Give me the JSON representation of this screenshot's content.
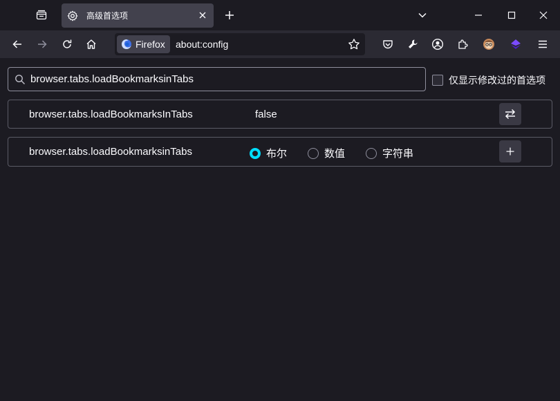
{
  "tab": {
    "title": "高级首选项"
  },
  "identity": {
    "label": "Firefox"
  },
  "urlbar": {
    "url": "about:config"
  },
  "search": {
    "query": "browser.tabs.loadBookmarksinTabs"
  },
  "filter": {
    "modified_only_label": "仅显示修改过的首选项"
  },
  "prefs": [
    {
      "name": "browser.tabs.loadBookmarksInTabs",
      "value": "false"
    },
    {
      "name": "browser.tabs.loadBookmarksinTabs"
    }
  ],
  "new_pref_types": {
    "boolean": "布尔",
    "number": "数值",
    "string": "字符串",
    "selected": "boolean"
  },
  "colors": {
    "accent": "#00ddff",
    "background": "#1c1b22",
    "toolbar": "#2b2a33",
    "tab_selected": "#42414d"
  },
  "icons": [
    "tab-list-icon",
    "gear-icon",
    "close-icon",
    "plus-icon",
    "chevron-down-icon",
    "minimize-icon",
    "maximize-icon",
    "back-icon",
    "forward-icon",
    "reload-icon",
    "home-icon",
    "firefox-logo-icon",
    "star-icon",
    "pocket-icon",
    "wrench-icon",
    "account-icon",
    "extensions-icon",
    "avatar-extension-icon",
    "purple-extension-icon",
    "menu-icon",
    "search-icon",
    "toggle-icon",
    "add-icon"
  ]
}
